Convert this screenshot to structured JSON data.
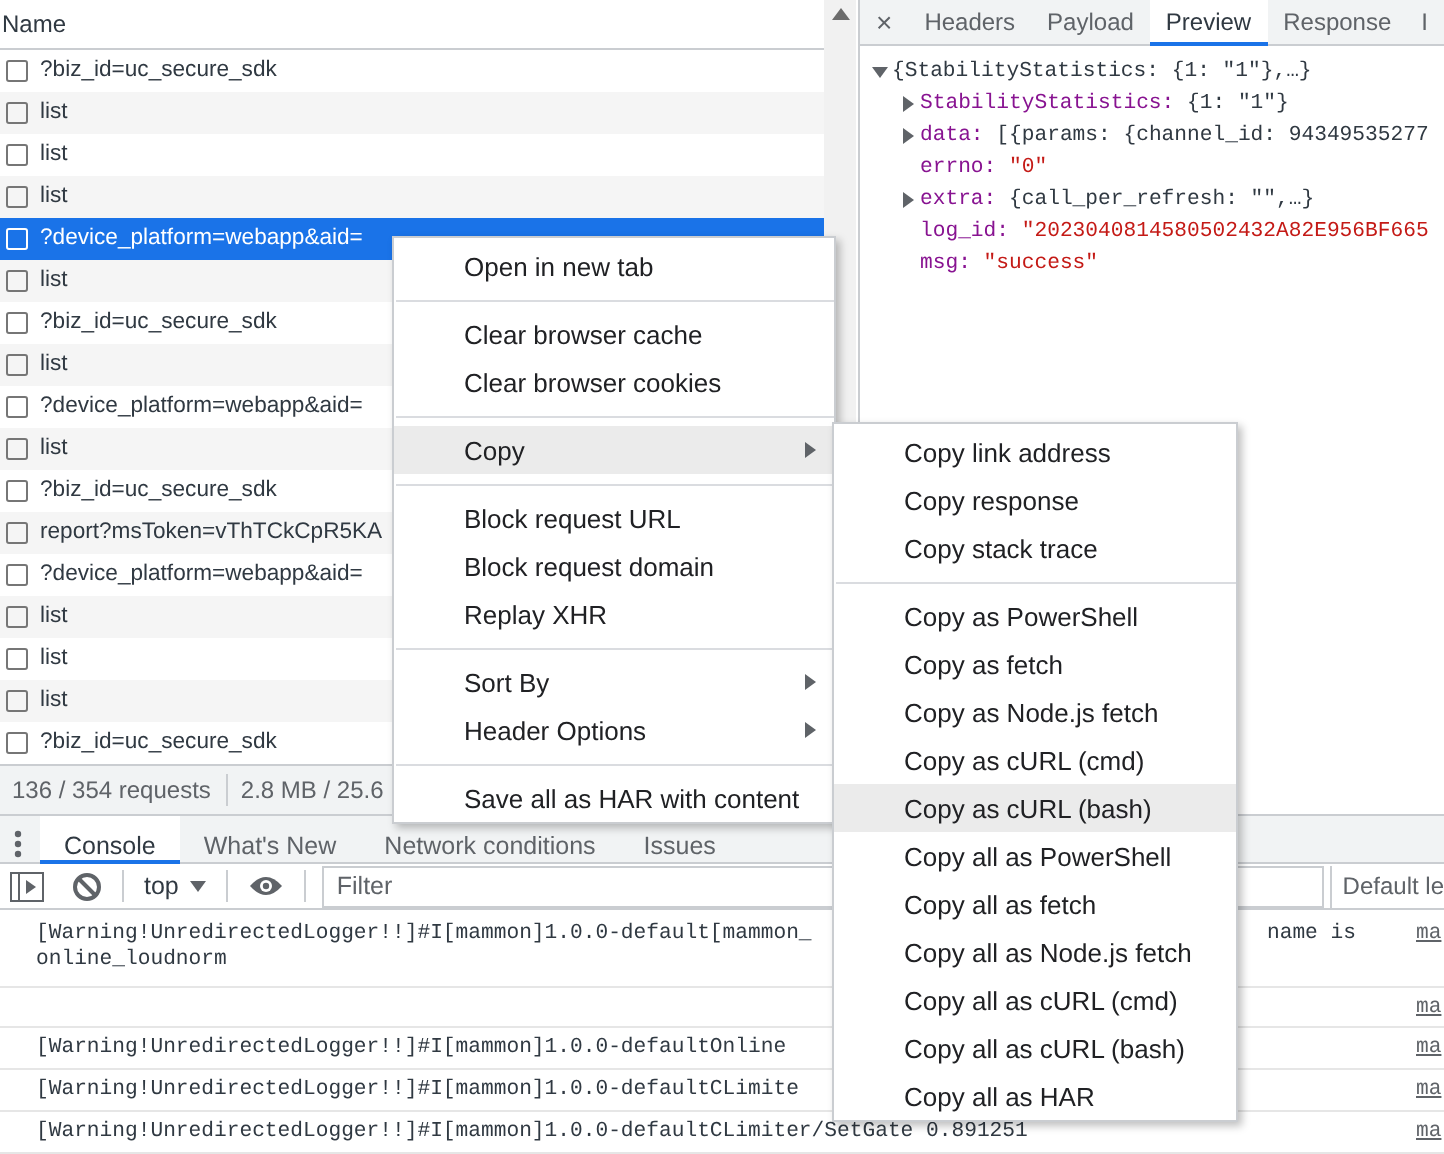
{
  "network": {
    "column": "Name",
    "rows": [
      {
        "name": "?biz_id=uc_secure_sdk",
        "checked": false,
        "selected": false
      },
      {
        "name": "list",
        "checked": false,
        "selected": false
      },
      {
        "name": "list",
        "checked": false,
        "selected": false
      },
      {
        "name": "list",
        "checked": false,
        "selected": false
      },
      {
        "name": "?device_platform=webapp&aid=",
        "checked": false,
        "selected": true
      },
      {
        "name": "list",
        "checked": false,
        "selected": false
      },
      {
        "name": "?biz_id=uc_secure_sdk",
        "checked": false,
        "selected": false
      },
      {
        "name": "list",
        "checked": false,
        "selected": false
      },
      {
        "name": "?device_platform=webapp&aid=",
        "checked": false,
        "selected": false
      },
      {
        "name": "list",
        "checked": false,
        "selected": false
      },
      {
        "name": "?biz_id=uc_secure_sdk",
        "checked": false,
        "selected": false
      },
      {
        "name": "report?msToken=vThTCkCpR5KA",
        "checked": false,
        "selected": false
      },
      {
        "name": "?device_platform=webapp&aid=",
        "checked": false,
        "selected": false
      },
      {
        "name": "list",
        "checked": false,
        "selected": false
      },
      {
        "name": "list",
        "checked": false,
        "selected": false
      },
      {
        "name": "list",
        "checked": false,
        "selected": false
      },
      {
        "name": "?biz_id=uc_secure_sdk",
        "checked": false,
        "selected": false
      }
    ],
    "status": {
      "requests": "136 / 354 requests",
      "transferred": "2.8 MB / 25.6"
    }
  },
  "preview": {
    "close": "×",
    "tabs": [
      {
        "label": "Headers",
        "selected": false
      },
      {
        "label": "Payload",
        "selected": false
      },
      {
        "label": "Preview",
        "selected": true
      },
      {
        "label": "Response",
        "selected": false
      },
      {
        "label": "I",
        "selected": false
      }
    ],
    "tree": {
      "text": "{StabilityStatistics: {1: \"1\"},…}",
      "expanded": true,
      "children": [
        {
          "key": "StabilityStatistics:",
          "value": "{1: \"1\"}",
          "kind": "object",
          "expanded": false
        },
        {
          "key": "data:",
          "value": "[{params: {channel_id: 94349535277",
          "kind": "object",
          "expanded": false
        },
        {
          "key": "errno:",
          "value": "\"0\"",
          "kind": "string"
        },
        {
          "key": "extra:",
          "value": "{call_per_refresh: \"\",…}",
          "kind": "object",
          "expanded": false
        },
        {
          "key": "log_id:",
          "value": "\"2023040814580502432A82E956BF665",
          "kind": "string"
        },
        {
          "key": "msg:",
          "value": "\"success\"",
          "kind": "string"
        }
      ]
    }
  },
  "drawer": {
    "tabs": [
      {
        "label": "Console",
        "selected": true
      },
      {
        "label": "What's New",
        "selected": false
      },
      {
        "label": "Network conditions",
        "selected": false
      },
      {
        "label": "Issues",
        "selected": false
      }
    ],
    "toolbar": {
      "context": "top",
      "filter_placeholder": "Filter",
      "levels": "Default le"
    },
    "messages": [
      {
        "kind": "log",
        "lines": [
          "[Warning!UnredirectedLogger!!]#I[mammon]1.0.0-default[mammon_",
          "online_loudnorm"
        ],
        "tail": "name is",
        "source": "ma"
      },
      {
        "kind": "blank",
        "source": "ma"
      },
      {
        "kind": "log",
        "lines": [
          "[Warning!UnredirectedLogger!!]#I[mammon]1.0.0-defaultOnline"
        ],
        "source": "ma"
      },
      {
        "kind": "log",
        "lines": [
          "[Warning!UnredirectedLogger!!]#I[mammon]1.0.0-defaultCLimite"
        ],
        "source": "ma"
      },
      {
        "kind": "log",
        "lines": [
          "[Warning!UnredirectedLogger!!]#I[mammon]1.0.0-defaultCLimiter/SetGate 0.891251"
        ],
        "source": "ma"
      }
    ]
  },
  "context_menu": {
    "items": [
      {
        "kind": "item",
        "label": "Open in new tab",
        "submenu": false,
        "highlighted": false
      },
      {
        "kind": "separator"
      },
      {
        "kind": "item",
        "label": "Clear browser cache",
        "submenu": false,
        "highlighted": false
      },
      {
        "kind": "item",
        "label": "Clear browser cookies",
        "submenu": false,
        "highlighted": false
      },
      {
        "kind": "separator"
      },
      {
        "kind": "item",
        "label": "Copy",
        "submenu": true,
        "highlighted": true
      },
      {
        "kind": "separator"
      },
      {
        "kind": "item",
        "label": "Block request URL",
        "submenu": false,
        "highlighted": false
      },
      {
        "kind": "item",
        "label": "Block request domain",
        "submenu": false,
        "highlighted": false
      },
      {
        "kind": "item",
        "label": "Replay XHR",
        "submenu": false,
        "highlighted": false
      },
      {
        "kind": "separator"
      },
      {
        "kind": "item",
        "label": "Sort By",
        "submenu": true,
        "highlighted": false
      },
      {
        "kind": "item",
        "label": "Header Options",
        "submenu": true,
        "highlighted": false
      },
      {
        "kind": "separator"
      },
      {
        "kind": "item",
        "label": "Save all as HAR with content",
        "submenu": false,
        "highlighted": false
      }
    ]
  },
  "copy_submenu": {
    "items": [
      {
        "kind": "item",
        "label": "Copy link address",
        "submenu": false,
        "highlighted": false
      },
      {
        "kind": "item",
        "label": "Copy response",
        "submenu": false,
        "highlighted": false
      },
      {
        "kind": "item",
        "label": "Copy stack trace",
        "submenu": false,
        "highlighted": false
      },
      {
        "kind": "separator"
      },
      {
        "kind": "item",
        "label": "Copy as PowerShell",
        "submenu": false,
        "highlighted": false
      },
      {
        "kind": "item",
        "label": "Copy as fetch",
        "submenu": false,
        "highlighted": false
      },
      {
        "kind": "item",
        "label": "Copy as Node.js fetch",
        "submenu": false,
        "highlighted": false
      },
      {
        "kind": "item",
        "label": "Copy as cURL (cmd)",
        "submenu": false,
        "highlighted": false
      },
      {
        "kind": "item",
        "label": "Copy as cURL (bash)",
        "submenu": false,
        "highlighted": true
      },
      {
        "kind": "item",
        "label": "Copy all as PowerShell",
        "submenu": false,
        "highlighted": false
      },
      {
        "kind": "item",
        "label": "Copy all as fetch",
        "submenu": false,
        "highlighted": false
      },
      {
        "kind": "item",
        "label": "Copy all as Node.js fetch",
        "submenu": false,
        "highlighted": false
      },
      {
        "kind": "item",
        "label": "Copy all as cURL (cmd)",
        "submenu": false,
        "highlighted": false
      },
      {
        "kind": "item",
        "label": "Copy all as cURL (bash)",
        "submenu": false,
        "highlighted": false
      },
      {
        "kind": "item",
        "label": "Copy all as HAR",
        "submenu": false,
        "highlighted": false
      }
    ]
  }
}
